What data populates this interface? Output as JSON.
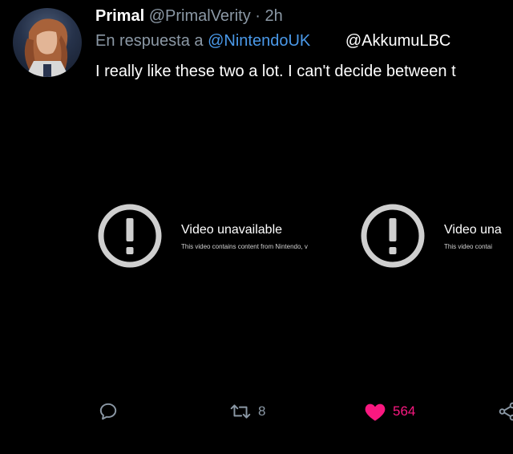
{
  "tweet": {
    "author_name": "Primal",
    "author_handle": "@PrimalVerity",
    "separator": "·",
    "time": "2h",
    "reply_prefix": "En respuesta a",
    "reply_to_1": "@NintendoUK",
    "reply_to_2": "@AkkumuLBC",
    "text": "I really like these two a lot. I can't decide between t"
  },
  "videos": [
    {
      "title": "Video unavailable",
      "subtitle": "This video contains content from Nintendo, v"
    },
    {
      "title": "Video una",
      "subtitle": "This video contai"
    }
  ],
  "actions": {
    "retweet_count": "8",
    "like_count": "564"
  },
  "colors": {
    "background": "#000000",
    "link": "#4a99e9",
    "muted": "#8b98a5",
    "like": "#f91880"
  },
  "icons": [
    "reply-icon",
    "retweet-icon",
    "heart-icon",
    "share-icon",
    "alert-icon"
  ]
}
